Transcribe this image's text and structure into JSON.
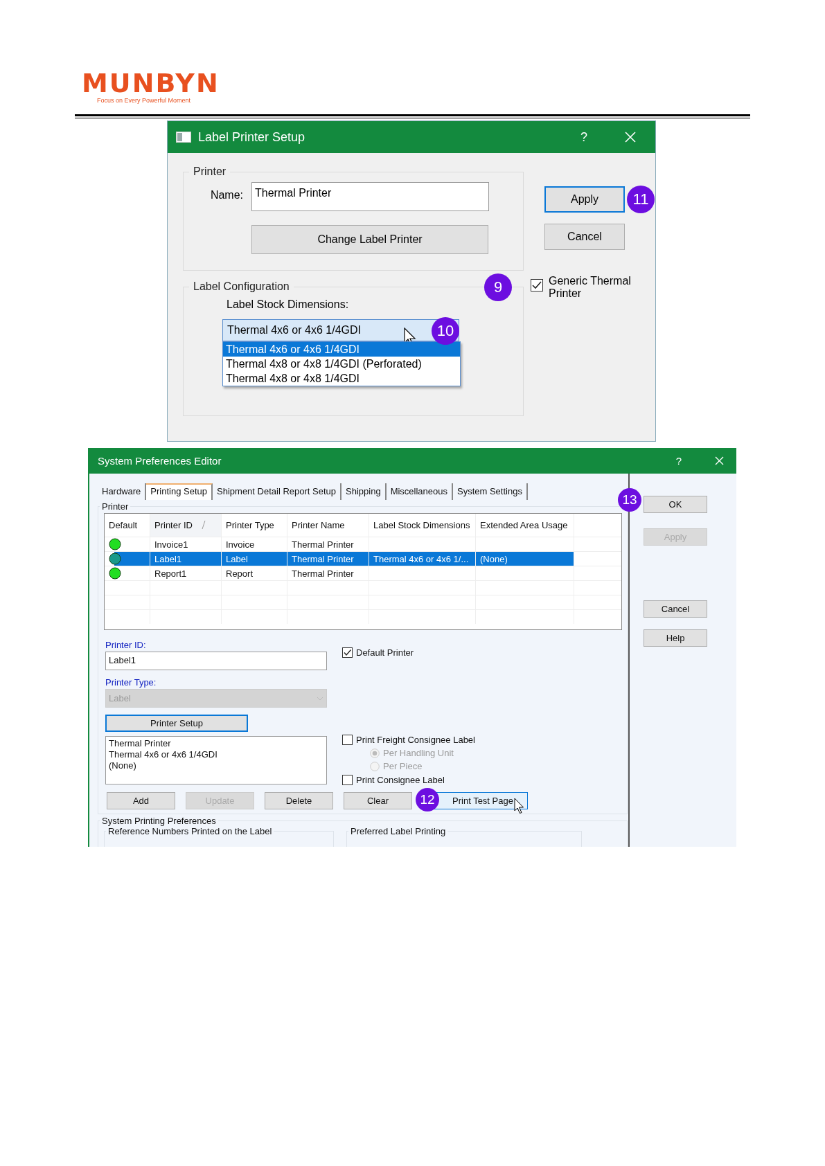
{
  "logo": {
    "brand": "MUNBYN",
    "tagline": "Focus on Every Powerful Moment"
  },
  "label_printer_setup": {
    "title": "Label Printer Setup",
    "help": "?",
    "printer_group": {
      "legend": "Printer",
      "name_label": "Name:",
      "name_value": "Thermal Printer",
      "change_button": "Change Label Printer"
    },
    "label_group": {
      "legend": "Label Configuration",
      "stock_label": "Label Stock Dimensions:",
      "stock_value": "Thermal 4x6 or 4x6 1/4GDI",
      "callout": "10",
      "options": [
        {
          "label": "Thermal 4x6 or 4x6 1/4GDI",
          "selected": true
        },
        {
          "label": "Thermal 4x8 or 4x8 1/4GDI (Perforated)",
          "selected": false
        },
        {
          "label": "Thermal 4x8 or 4x8 1/4GDI",
          "selected": false
        }
      ]
    },
    "buttons": [
      {
        "label": "Apply",
        "focused": true,
        "callout": "11"
      },
      {
        "label": "Cancel",
        "focused": false
      }
    ],
    "generic_checkbox": {
      "label": "Generic Thermal Printer",
      "checked": true,
      "callout": "9"
    }
  },
  "system_preferences_editor": {
    "title": "System Preferences Editor",
    "help": "?",
    "tabs": [
      {
        "label": "Hardware",
        "selected": false
      },
      {
        "label": "Printing Setup",
        "selected": true
      },
      {
        "label": "Shipment Detail Report Setup",
        "selected": false
      },
      {
        "label": "Shipping",
        "selected": false
      },
      {
        "label": "Miscellaneous",
        "selected": false
      },
      {
        "label": "System Settings",
        "selected": false
      }
    ],
    "printer_group": {
      "legend": "Printer",
      "columns": [
        "Default",
        "Printer ID",
        "Printer Type",
        "Printer Name",
        "Label Stock Dimensions",
        "Extended Area Usage"
      ],
      "rows": [
        {
          "selected": false,
          "cells": [
            "",
            "Invoice1",
            "Invoice",
            "Thermal Printer",
            "",
            ""
          ]
        },
        {
          "selected": true,
          "cells": [
            "",
            "Label1",
            "Label",
            "Thermal Printer",
            "Thermal 4x6 or 4x6 1/...",
            "(None)"
          ]
        },
        {
          "selected": false,
          "cells": [
            "",
            "Report1",
            "Report",
            "Thermal Printer",
            "",
            ""
          ]
        }
      ],
      "printer_id_label": "Printer ID:",
      "printer_id_value": "Label1",
      "printer_type_label": "Printer Type:",
      "printer_type_value": "Label",
      "printer_setup_button": "Printer Setup",
      "summary": [
        "Thermal Printer",
        "Thermal 4x6 or 4x6 1/4GDI",
        "(None)"
      ],
      "default_printer": {
        "label": "Default Printer",
        "checked": true
      },
      "freight_label": {
        "label": "Print Freight Consignee Label",
        "checked": false
      },
      "freight_options": [
        {
          "label": "Per Handling Unit",
          "selected": true
        },
        {
          "label": "Per Piece",
          "selected": false
        }
      ],
      "consignee_label": {
        "label": "Print Consignee Label",
        "checked": false
      },
      "actions": [
        {
          "label": "Add",
          "disabled": false
        },
        {
          "label": "Update",
          "disabled": true
        },
        {
          "label": "Delete",
          "disabled": false
        },
        {
          "label": "Clear",
          "disabled": false
        },
        {
          "label": "Print Test Page",
          "disabled": false,
          "callout": "12"
        }
      ]
    },
    "preferences_group": {
      "legend": "System Printing Preferences",
      "subgroups": [
        "Reference Numbers Printed on the Label",
        "Preferred Label Printing"
      ]
    },
    "side_buttons": [
      {
        "label": "OK",
        "disabled": false,
        "callout": "13"
      },
      {
        "label": "Apply",
        "disabled": true
      },
      {
        "label": "Cancel",
        "disabled": false
      },
      {
        "label": "Help",
        "disabled": false
      }
    ]
  }
}
